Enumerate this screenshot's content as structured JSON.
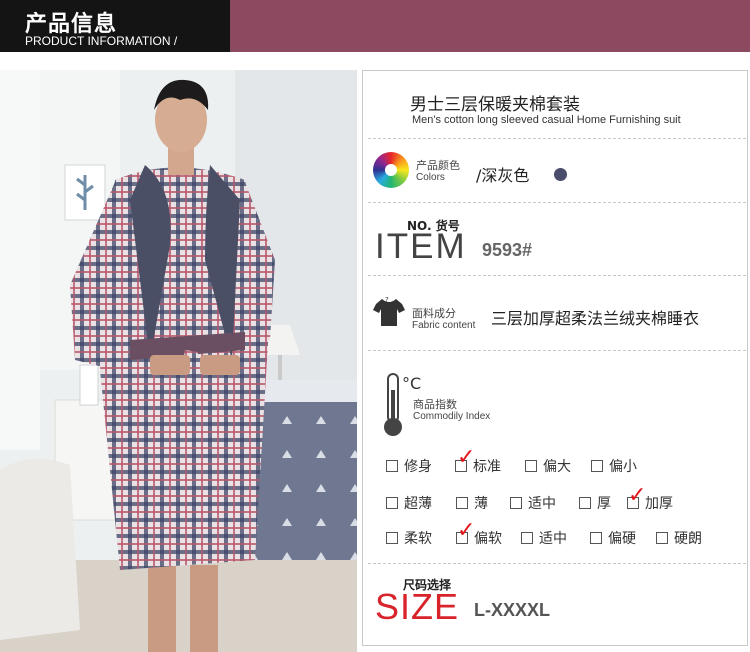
{
  "header": {
    "title_cn": "产品信息",
    "title_en": "PRODUCT INFORMATION /"
  },
  "colors": {
    "header_dark": "#141414",
    "header_accent": "#8b4a5f",
    "check_red": "#e2141b",
    "size_red": "#d8232a",
    "swatch": "#4a4d6b"
  },
  "product": {
    "name_cn": "男士三层保暖夹棉套装",
    "name_en": "Men's cotton long sleeved casual Home Furnishing suit"
  },
  "color_row": {
    "label_cn": "产品颜色",
    "label_en": "Colors",
    "value": "/深灰色",
    "icon": "color-wheel-icon"
  },
  "item_row": {
    "label_cn": "NO. 货号",
    "label_big": "ITEM",
    "value": "9593#"
  },
  "fabric_row": {
    "label_cn": "面料成分",
    "label_en": "Fabric content",
    "value": "三层加厚超柔法兰绒夹棉睡衣",
    "icon": "tshirt-icon"
  },
  "index_row": {
    "label_cn": "商品指数",
    "label_en": "Commodily Index",
    "unit": "°C",
    "icon": "thermometer-icon"
  },
  "fit_options": [
    {
      "label": "修身",
      "checked": false
    },
    {
      "label": "标准",
      "checked": true
    },
    {
      "label": "偏大",
      "checked": false
    },
    {
      "label": "偏小",
      "checked": false
    }
  ],
  "thickness_options": [
    {
      "label": "超薄",
      "checked": false
    },
    {
      "label": "薄",
      "checked": false
    },
    {
      "label": "适中",
      "checked": false
    },
    {
      "label": "厚",
      "checked": false
    },
    {
      "label": "加厚",
      "checked": true
    }
  ],
  "softness_options": [
    {
      "label": "柔软",
      "checked": false
    },
    {
      "label": "偏软",
      "checked": true
    },
    {
      "label": "适中",
      "checked": false
    },
    {
      "label": "偏硬",
      "checked": false
    },
    {
      "label": "硬朗",
      "checked": false
    }
  ],
  "size_row": {
    "label_cn": "尺码选择",
    "label_big": "SIZE",
    "value": "L-XXXXL"
  }
}
